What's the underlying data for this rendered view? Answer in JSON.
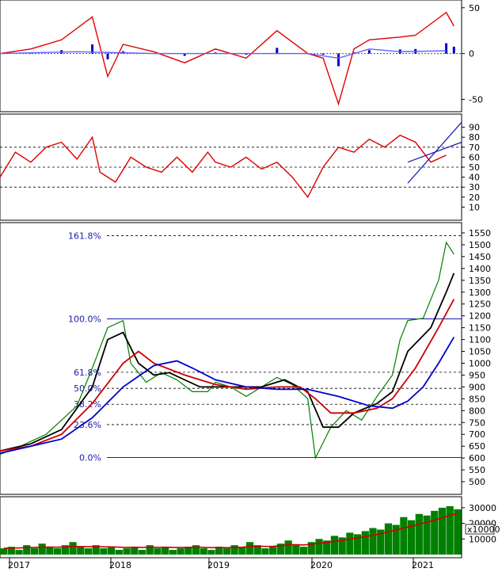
{
  "chart_data": [
    {
      "panel": "macd",
      "type": "line",
      "y_ticks": [
        "50",
        "0",
        "-50"
      ],
      "ylim": [
        -60,
        55
      ],
      "series": [
        {
          "color": "#e00000",
          "points": [
            [
              0,
              0
            ],
            [
              20,
              5
            ],
            [
              40,
              15
            ],
            [
              60,
              40
            ],
            [
              70,
              -25
            ],
            [
              80,
              10
            ],
            [
              100,
              2
            ],
            [
              120,
              -10
            ],
            [
              140,
              5
            ],
            [
              160,
              -5
            ],
            [
              180,
              25
            ],
            [
              200,
              0
            ],
            [
              210,
              -5
            ],
            [
              220,
              -55
            ],
            [
              230,
              5
            ],
            [
              240,
              15
            ],
            [
              260,
              18
            ],
            [
              270,
              20
            ],
            [
              290,
              45
            ],
            [
              295,
              30
            ]
          ]
        },
        {
          "color": "#6060ff",
          "points": [
            [
              0,
              0
            ],
            [
              50,
              2
            ],
            [
              100,
              0
            ],
            [
              150,
              0
            ],
            [
              200,
              0
            ],
            [
              220,
              -5
            ],
            [
              240,
              5
            ],
            [
              260,
              2
            ],
            [
              290,
              3
            ]
          ]
        }
      ],
      "histogram_color": "#0000cc"
    },
    {
      "panel": "rsi",
      "type": "line",
      "y_ticks": [
        "90",
        "80",
        "70",
        "60",
        "50",
        "40",
        "30",
        "20",
        "10"
      ],
      "ylim": [
        0,
        100
      ],
      "reference_lines": [
        70,
        50,
        30
      ],
      "series": [
        {
          "color": "#e00000",
          "points": [
            [
              0,
              40
            ],
            [
              10,
              65
            ],
            [
              20,
              55
            ],
            [
              30,
              70
            ],
            [
              40,
              75
            ],
            [
              50,
              58
            ],
            [
              60,
              80
            ],
            [
              65,
              45
            ],
            [
              75,
              35
            ],
            [
              85,
              60
            ],
            [
              95,
              50
            ],
            [
              105,
              45
            ],
            [
              115,
              60
            ],
            [
              125,
              45
            ],
            [
              135,
              65
            ],
            [
              140,
              55
            ],
            [
              150,
              50
            ],
            [
              160,
              60
            ],
            [
              170,
              48
            ],
            [
              180,
              55
            ],
            [
              190,
              40
            ],
            [
              200,
              20
            ],
            [
              210,
              50
            ],
            [
              220,
              70
            ],
            [
              230,
              65
            ],
            [
              240,
              78
            ],
            [
              250,
              70
            ],
            [
              260,
              82
            ],
            [
              270,
              75
            ],
            [
              280,
              55
            ],
            [
              290,
              62
            ]
          ]
        }
      ],
      "trend_lines": [
        {
          "color": "#1a1ab4",
          "points": [
            [
              265,
              34
            ],
            [
              300,
              95
            ]
          ]
        },
        {
          "color": "#1a1ab4",
          "points": [
            [
              265,
              55
            ],
            [
              300,
              75
            ]
          ]
        }
      ]
    },
    {
      "panel": "price",
      "type": "line",
      "y_ticks": [
        "1550",
        "1500",
        "1450",
        "1400",
        "1350",
        "1300",
        "1250",
        "1200",
        "1150",
        "1100",
        "1050",
        "1000",
        "950",
        "900",
        "850",
        "800",
        "750",
        "700",
        "650",
        "600",
        "550",
        "500"
      ],
      "ylim": [
        460,
        1580
      ],
      "fibonacci": [
        {
          "label": "161.8%",
          "value": 1538
        },
        {
          "label": "100.0%",
          "value": 1187
        },
        {
          "label": "61.8%",
          "value": 962
        },
        {
          "label": "50.0%",
          "value": 894
        },
        {
          "label": "38.2%",
          "value": 827
        },
        {
          "label": "23.6%",
          "value": 741
        },
        {
          "label": "0.0%",
          "value": 602
        }
      ],
      "series": [
        {
          "color": "#008000",
          "points": [
            [
              0,
              615
            ],
            [
              10,
              640
            ],
            [
              20,
              670
            ],
            [
              30,
              700
            ],
            [
              40,
              760
            ],
            [
              50,
              820
            ],
            [
              60,
              980
            ],
            [
              70,
              1150
            ],
            [
              80,
              1180
            ],
            [
              85,
              1000
            ],
            [
              95,
              920
            ],
            [
              105,
              960
            ],
            [
              115,
              930
            ],
            [
              125,
              880
            ],
            [
              135,
              880
            ],
            [
              140,
              920
            ],
            [
              150,
              900
            ],
            [
              160,
              860
            ],
            [
              170,
              900
            ],
            [
              180,
              940
            ],
            [
              190,
              910
            ],
            [
              200,
              850
            ],
            [
              205,
              600
            ],
            [
              215,
              730
            ],
            [
              225,
              800
            ],
            [
              235,
              760
            ],
            [
              245,
              860
            ],
            [
              255,
              950
            ],
            [
              260,
              1100
            ],
            [
              265,
              1180
            ],
            [
              275,
              1190
            ],
            [
              285,
              1350
            ],
            [
              290,
              1510
            ],
            [
              295,
              1460
            ]
          ]
        },
        {
          "color": "#000000",
          "points": [
            [
              0,
              630
            ],
            [
              20,
              660
            ],
            [
              40,
              720
            ],
            [
              60,
              900
            ],
            [
              70,
              1100
            ],
            [
              80,
              1130
            ],
            [
              90,
              1000
            ],
            [
              100,
              950
            ],
            [
              110,
              960
            ],
            [
              130,
              900
            ],
            [
              150,
              900
            ],
            [
              170,
              900
            ],
            [
              185,
              930
            ],
            [
              200,
              880
            ],
            [
              210,
              730
            ],
            [
              220,
              730
            ],
            [
              230,
              790
            ],
            [
              245,
              830
            ],
            [
              255,
              880
            ],
            [
              265,
              1050
            ],
            [
              280,
              1150
            ],
            [
              290,
              1300
            ],
            [
              295,
              1380
            ]
          ]
        },
        {
          "color": "#cc0000",
          "points": [
            [
              0,
              630
            ],
            [
              20,
              650
            ],
            [
              40,
              700
            ],
            [
              60,
              830
            ],
            [
              80,
              1000
            ],
            [
              90,
              1050
            ],
            [
              100,
              1000
            ],
            [
              120,
              950
            ],
            [
              140,
              910
            ],
            [
              160,
              890
            ],
            [
              180,
              900
            ],
            [
              195,
              900
            ],
            [
              205,
              850
            ],
            [
              215,
              790
            ],
            [
              230,
              790
            ],
            [
              245,
              810
            ],
            [
              255,
              850
            ],
            [
              270,
              980
            ],
            [
              285,
              1150
            ],
            [
              295,
              1270
            ]
          ]
        },
        {
          "color": "#0000cc",
          "points": [
            [
              0,
              620
            ],
            [
              20,
              650
            ],
            [
              40,
              680
            ],
            [
              60,
              770
            ],
            [
              80,
              900
            ],
            [
              100,
              990
            ],
            [
              115,
              1010
            ],
            [
              125,
              980
            ],
            [
              140,
              930
            ],
            [
              160,
              900
            ],
            [
              180,
              890
            ],
            [
              200,
              890
            ],
            [
              220,
              860
            ],
            [
              240,
              820
            ],
            [
              255,
              810
            ],
            [
              265,
              840
            ],
            [
              275,
              900
            ],
            [
              285,
              1000
            ],
            [
              295,
              1110
            ]
          ]
        }
      ]
    },
    {
      "panel": "volume",
      "type": "bar",
      "y_ticks": [
        "30000",
        "20000",
        "10000"
      ],
      "multiplier_label": "x10000",
      "ylim": [
        0,
        35000
      ],
      "bar_color": "#008000",
      "ma_color": "#cc0000",
      "values": [
        4000,
        5000,
        3000,
        6000,
        4000,
        7000,
        5000,
        4000,
        6000,
        8000,
        5000,
        4000,
        6000,
        4000,
        5000,
        3000,
        4000,
        5000,
        3000,
        6000,
        4000,
        5000,
        3000,
        4000,
        5000,
        6000,
        4000,
        3000,
        5000,
        4000,
        6000,
        5000,
        8000,
        6000,
        4000,
        5000,
        7000,
        9000,
        6000,
        5000,
        8000,
        10000,
        9000,
        12000,
        11000,
        14000,
        13000,
        15000,
        17000,
        16000,
        20000,
        19000,
        24000,
        22000,
        26000,
        25000,
        28000,
        30000,
        31000,
        29000
      ],
      "ma_values": [
        4000,
        4200,
        4200,
        4500,
        4500,
        4700,
        4800,
        4700,
        4900,
        5200,
        5100,
        5000,
        5100,
        4900,
        4900,
        4700,
        4600,
        4700,
        4500,
        4700,
        4600,
        4700,
        4500,
        4500,
        4600,
        4800,
        4600,
        4400,
        4500,
        4400,
        4600,
        4700,
        5200,
        5400,
        5200,
        5300,
        5700,
        6300,
        6300,
        6200,
        6600,
        7300,
        7700,
        8500,
        9100,
        10000,
        10700,
        11500,
        12500,
        13300,
        14700,
        15600,
        17100,
        18100,
        19600,
        20700,
        22100,
        23600,
        25200,
        26200
      ]
    },
    {
      "panel": "time-axis",
      "type": "axis",
      "x_labels": [
        "2017",
        "2018",
        "2019",
        "2020",
        "2021"
      ]
    }
  ]
}
